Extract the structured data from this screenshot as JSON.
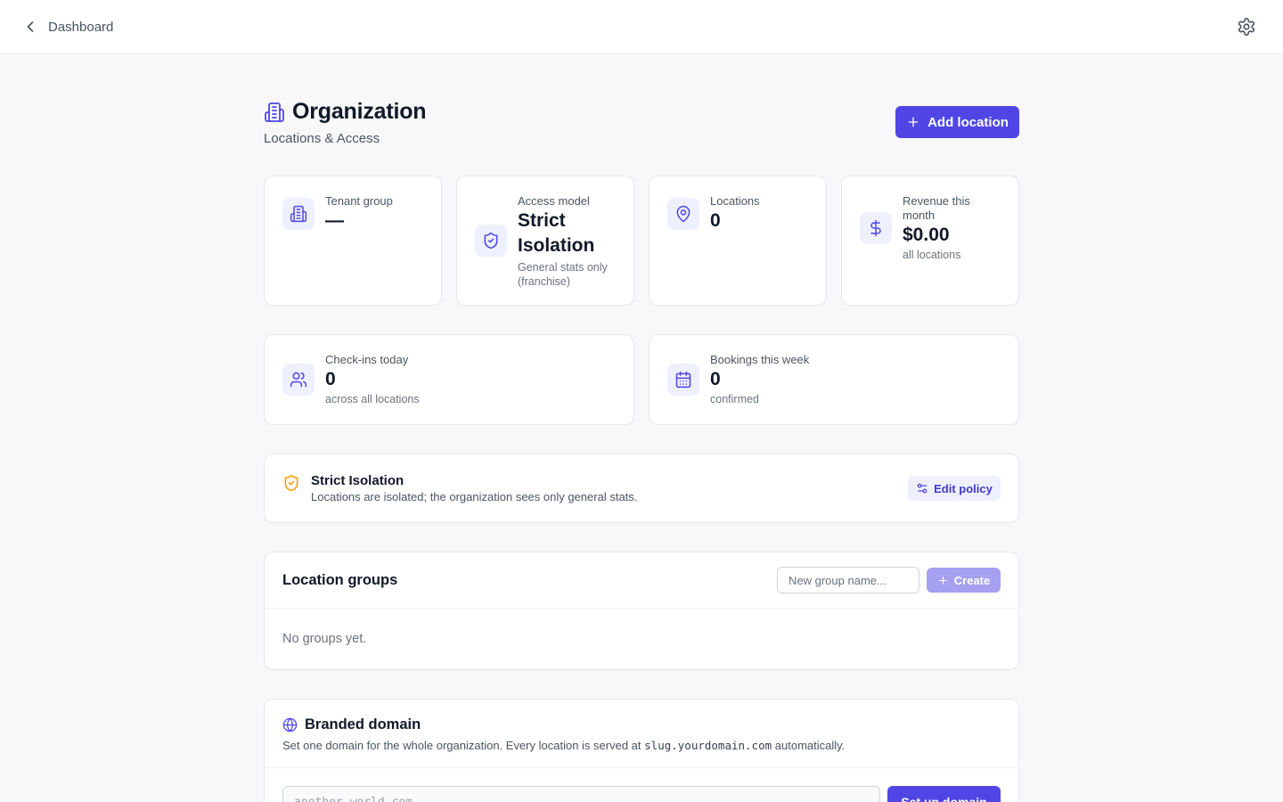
{
  "topbar": {
    "back_label": "Dashboard",
    "back_icon": "chevron-left-icon",
    "settings_icon": "gear-icon"
  },
  "header": {
    "title": "Organization",
    "subtitle": "Locations & Access",
    "title_icon": "building-icon",
    "add_location_label": "Add location"
  },
  "stats": {
    "tenant_group": {
      "label": "Tenant group",
      "value": "—"
    },
    "access_model": {
      "label": "Access model",
      "value": "Strict Isolation",
      "sub": "General stats only (franchise)"
    },
    "locations": {
      "label": "Locations",
      "value": "0"
    },
    "revenue": {
      "label": "Revenue this month",
      "value": "$0.00",
      "sub": "all locations"
    },
    "checkins": {
      "label": "Check-ins today",
      "value": "0",
      "sub": "across all locations"
    },
    "bookings": {
      "label": "Bookings this week",
      "value": "0",
      "sub": "confirmed"
    }
  },
  "policy": {
    "title": "Strict Isolation",
    "description": "Locations are isolated; the organization sees only general stats.",
    "edit_label": "Edit policy"
  },
  "groups": {
    "title": "Location groups",
    "input_placeholder": "New group name...",
    "create_label": "Create",
    "empty_text": "No groups yet."
  },
  "domain": {
    "title": "Branded domain",
    "desc_before": "Set one domain for the whole organization. Every location is served at",
    "desc_code": "slug.yourdomain.com",
    "desc_after": "automatically.",
    "input_placeholder": "another.world.com",
    "setup_label": "Set up domain"
  },
  "colors": {
    "accent": "#4f46e5",
    "accent_soft": "#eef0fd",
    "warning": "#f59e0b",
    "background": "#f8f8fa"
  }
}
